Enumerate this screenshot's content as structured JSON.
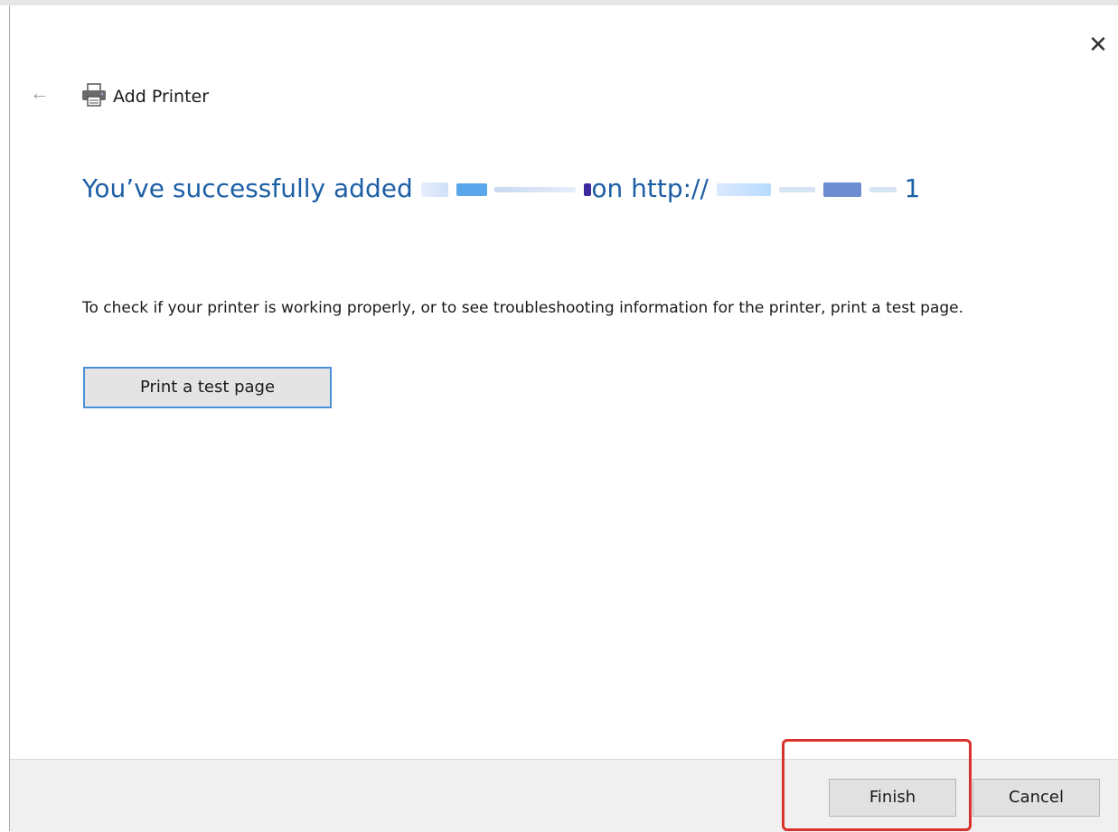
{
  "colors": {
    "heading": "#1d5fa5",
    "highlight": "#d9322a",
    "button_focus_border": "#4a90d9",
    "footer_bg": "#f0f0f0"
  },
  "window": {
    "title": "Add Printer",
    "back_icon": "back-arrow-icon",
    "close_icon": "close-icon",
    "printer_icon": "printer-icon"
  },
  "main": {
    "heading_prefix": "You’ve successfully added",
    "heading_middle": "on http://",
    "heading_suffix": "1",
    "description": "To check if your printer is working properly, or to see troubleshooting information for the printer, print a test page.",
    "test_button_label": "Print a test page"
  },
  "footer": {
    "finish_label": "Finish",
    "cancel_label": "Cancel"
  }
}
